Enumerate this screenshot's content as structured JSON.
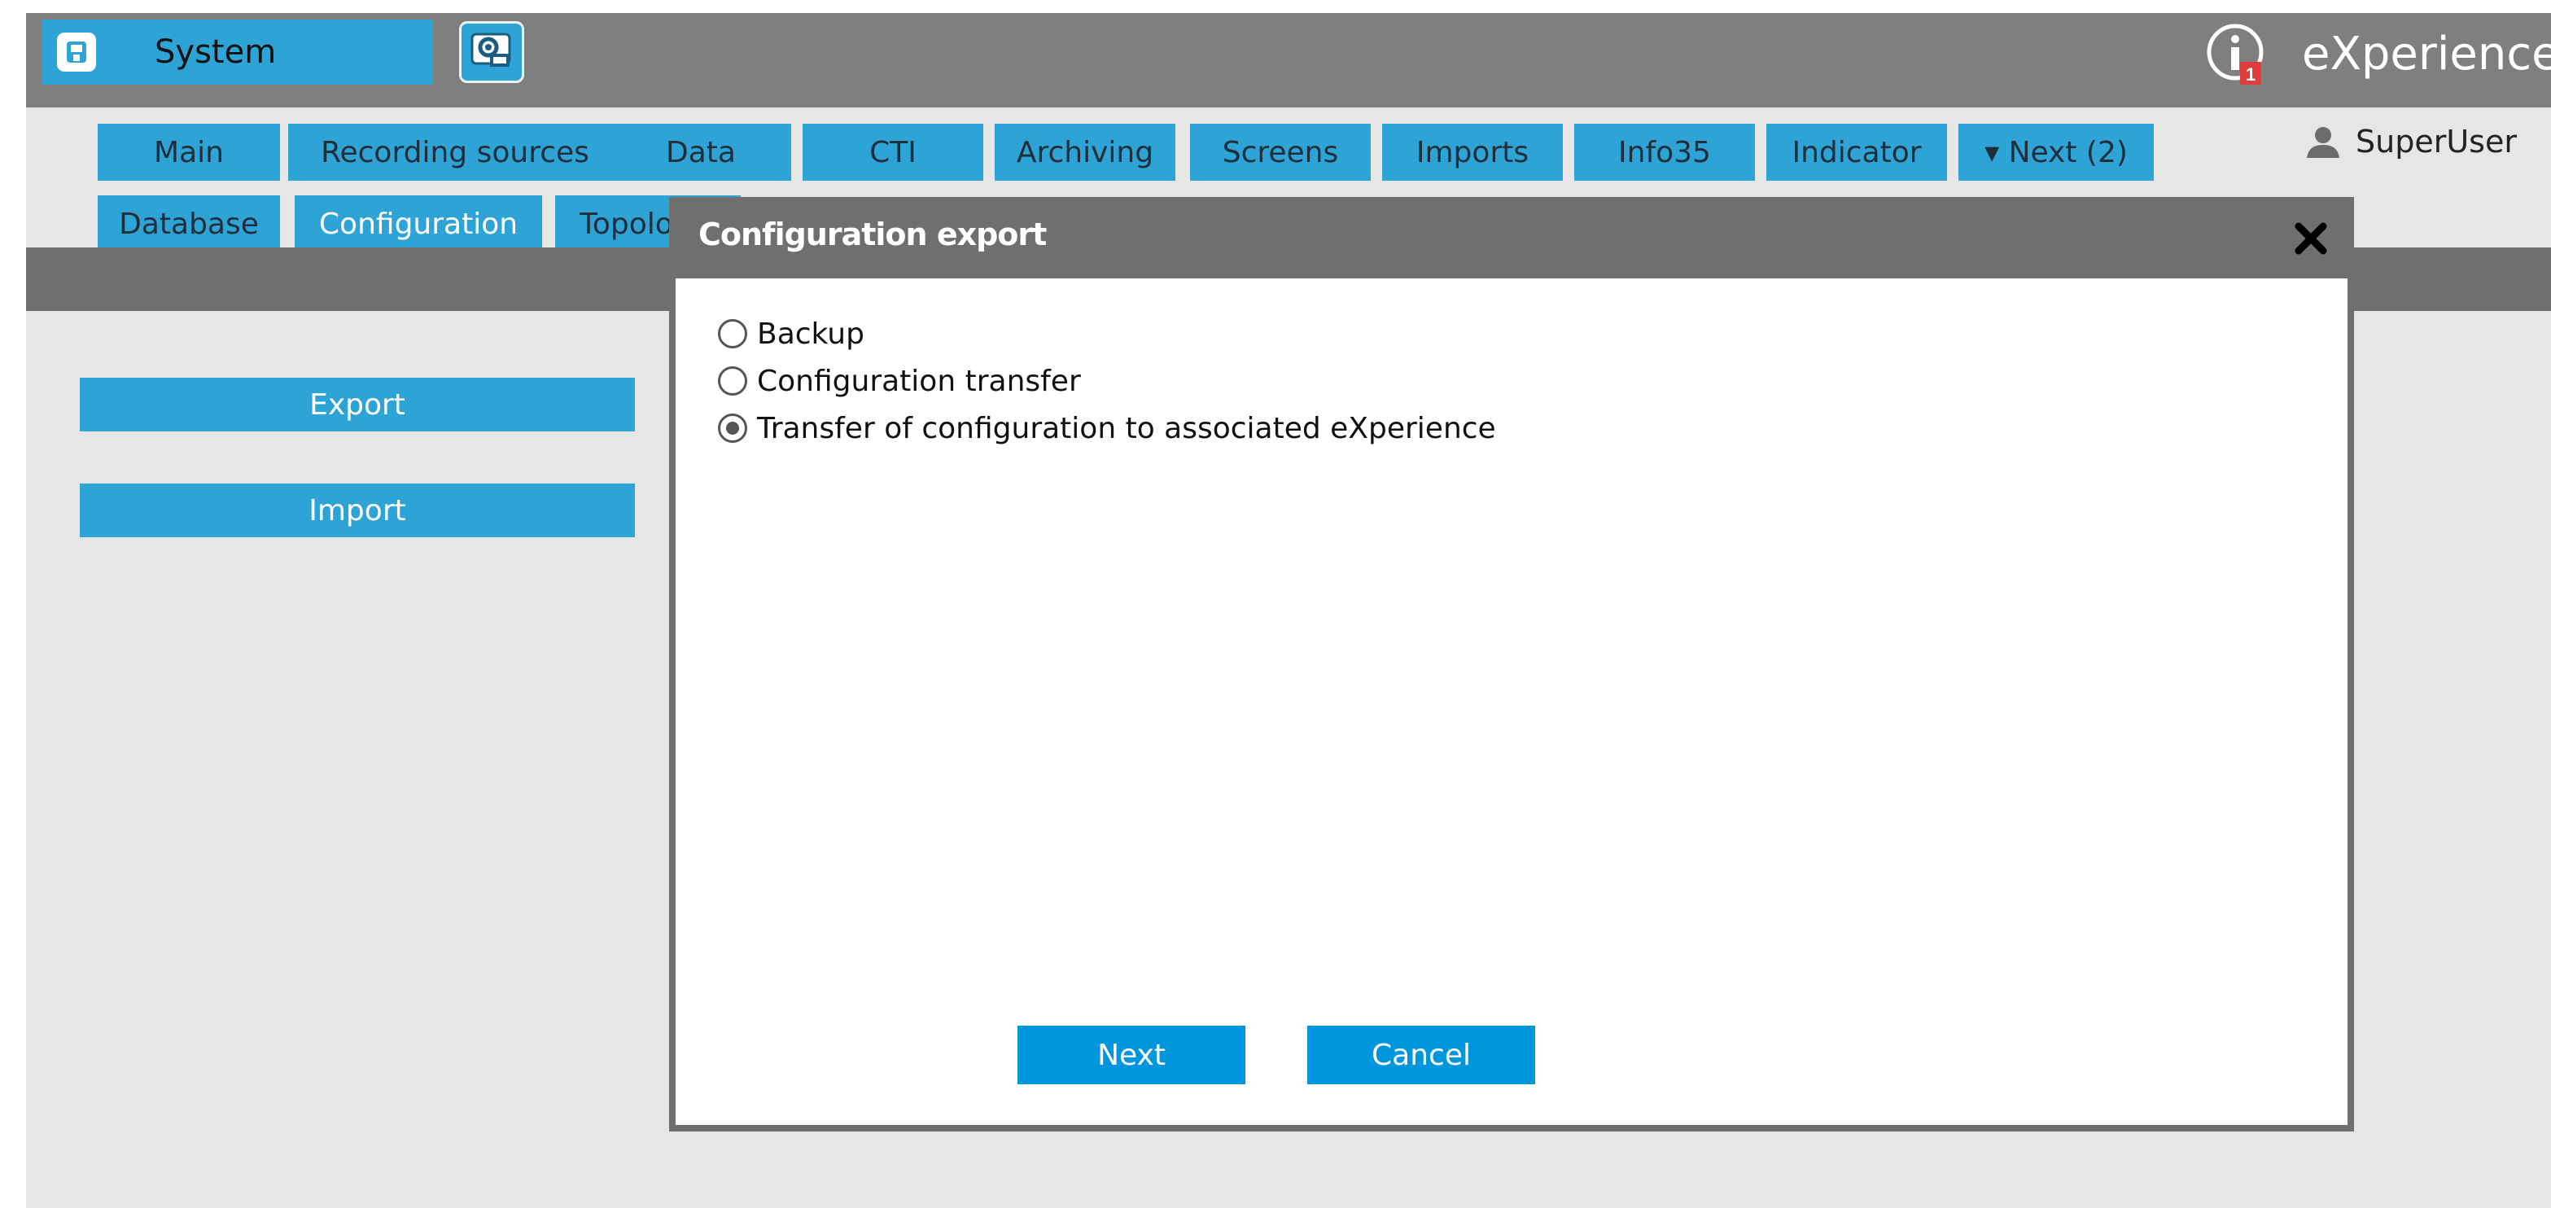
{
  "header": {
    "module_label": "System",
    "brand": "eXperience",
    "notification_count": "1"
  },
  "tabs": [
    {
      "label": "Main"
    },
    {
      "label": "Recording sources"
    },
    {
      "label": "Data"
    },
    {
      "label": "CTI"
    },
    {
      "label": "Archiving"
    },
    {
      "label": "Screens"
    },
    {
      "label": "Imports"
    },
    {
      "label": "Info35"
    },
    {
      "label": "Indicator"
    },
    {
      "label": "▾ Next (2)"
    }
  ],
  "subtabs": [
    {
      "label": "Database"
    },
    {
      "label": "Configuration"
    },
    {
      "label": "Topology"
    }
  ],
  "user": {
    "name": "SuperUser"
  },
  "sidebar": {
    "export_label": "Export",
    "import_label": "Import"
  },
  "dialog": {
    "title": "Configuration export",
    "options": [
      {
        "label": "Backup",
        "selected": false
      },
      {
        "label": "Configuration transfer",
        "selected": false
      },
      {
        "label": "Transfer of configuration to associated eXperience",
        "selected": true
      }
    ],
    "next_label": "Next",
    "cancel_label": "Cancel"
  },
  "colors": {
    "accent": "#2ea3d6",
    "primary_button": "#0096dd",
    "header_bg": "#7f7f7f"
  }
}
